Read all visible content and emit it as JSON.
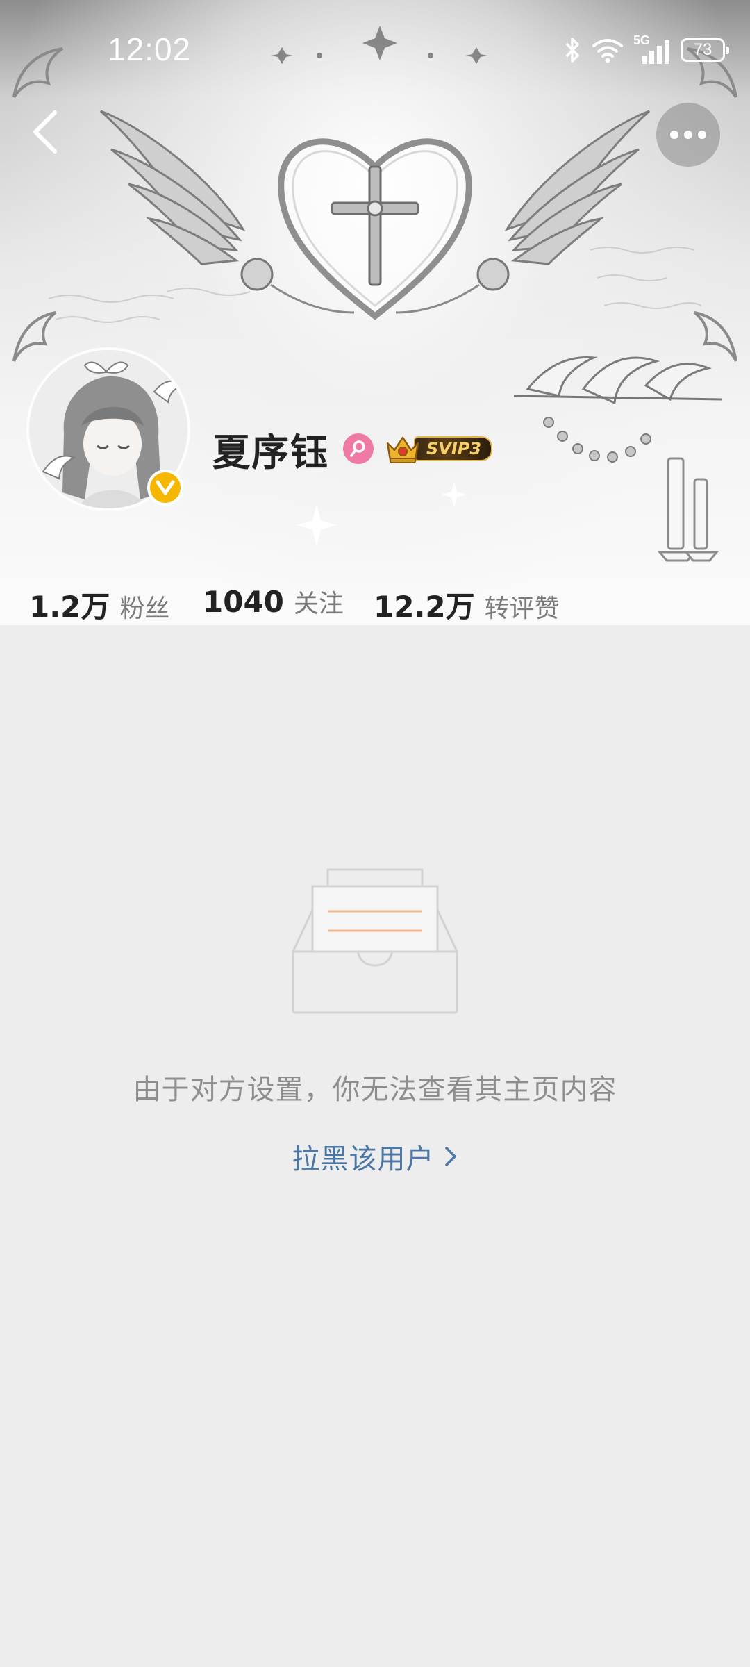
{
  "status_bar": {
    "time": "12:02",
    "network": "5G",
    "battery": "73"
  },
  "header": {
    "back_icon": "chevron-left-icon",
    "more_icon": "more-horizontal-icon"
  },
  "profile": {
    "username": "夏序钰",
    "gender_icon": "female-icon",
    "verified_icon": "verified-v-icon",
    "vip_badge": "SVIP3"
  },
  "stats": [
    {
      "value": "1.2万",
      "label": "粉丝"
    },
    {
      "value": "1040",
      "label": "关注"
    },
    {
      "value": "12.2万",
      "label": "转评赞"
    }
  ],
  "empty_state": {
    "icon": "empty-inbox-icon",
    "message": "由于对方设置，你无法查看其主页内容",
    "action_label": "拉黑该用户"
  },
  "colors": {
    "page_background": "#ededed",
    "link": "#4b77a6",
    "muted_text": "#8e8e8e",
    "gender_female": "#f07aa6",
    "verified": "#f5b700",
    "vip_gold": "#f5cf6a"
  }
}
